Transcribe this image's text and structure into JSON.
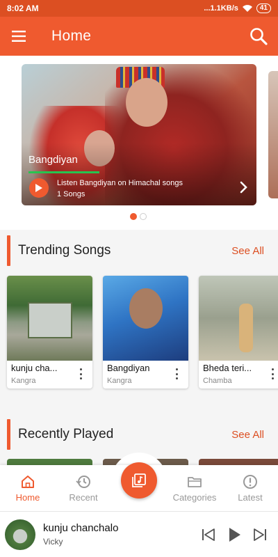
{
  "status_bar": {
    "time": "8:02 AM",
    "network_speed": "...1.1KB/s",
    "battery": "41"
  },
  "app_bar": {
    "title": "Home",
    "menu_icon": "hamburger-menu-icon",
    "search_icon": "search-icon"
  },
  "banner": {
    "title": "Bangdiyan",
    "description": "Listen Bangdiyan on Himachal songs",
    "songs_count": "1 Songs",
    "active_slide": 1,
    "total_slides": 2
  },
  "trending": {
    "title": "Trending Songs",
    "see_all": "See All",
    "items": [
      {
        "name": "kunju cha...",
        "region": "Kangra"
      },
      {
        "name": "Bangdiyan",
        "region": "Kangra"
      },
      {
        "name": "Bheda teri...",
        "region": "Chamba"
      }
    ]
  },
  "recent": {
    "title": "Recently Played",
    "see_all": "See All"
  },
  "bottom_nav": {
    "items": [
      {
        "label": "Home",
        "icon": "home-icon",
        "active": true
      },
      {
        "label": "Recent",
        "icon": "history-icon",
        "active": false
      },
      {
        "label": "Categories",
        "icon": "folder-icon",
        "active": false
      },
      {
        "label": "Latest",
        "icon": "alert-clock-icon",
        "active": false
      }
    ],
    "center_icon": "music-library-icon"
  },
  "now_playing": {
    "title": "kunju chanchalo",
    "artist": "Vicky"
  },
  "colors": {
    "accent": "#ef5a2f",
    "status_bar": "#dc4f22",
    "progress": "#27c44f"
  }
}
